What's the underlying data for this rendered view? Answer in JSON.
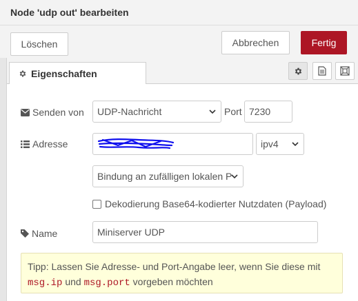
{
  "header": {
    "title": "Node 'udp out' bearbeiten"
  },
  "toolbar": {
    "delete_label": "Löschen",
    "cancel_label": "Abbrechen",
    "done_label": "Fertig"
  },
  "tabs": {
    "properties_label": "Eigenschaften"
  },
  "form": {
    "send_label": "Senden von",
    "send_value": "UDP-Nachricht",
    "port_label": "Port",
    "port_value": "7230",
    "address_label": "Adresse",
    "address_value": "",
    "ip_version": "ipv4",
    "bind_value": "Bindung an zufälligen lokalen P",
    "checkbox_label": "Dekodierung Base64-kodierter Nutzdaten (Payload)",
    "checkbox_checked": false,
    "name_label": "Name",
    "name_value": "Miniserver UDP"
  },
  "tip": {
    "prefix": "Tipp: Lassen Sie Adresse- und Port-Angabe leer, wenn Sie diese mit",
    "code1": "msg.ip",
    "middle": "und",
    "code2": "msg.port",
    "suffix": "vorgeben möchten"
  },
  "colors": {
    "primary": "#ad1625",
    "tip_background": "#ffffdb",
    "scribble": "#1010ee"
  },
  "icons": {
    "tab": "gear-icon",
    "send": "envelope-icon",
    "address": "list-icon",
    "name": "tag-icon",
    "tab_buttons": [
      "gear-icon",
      "document-icon",
      "frame-icon"
    ]
  }
}
